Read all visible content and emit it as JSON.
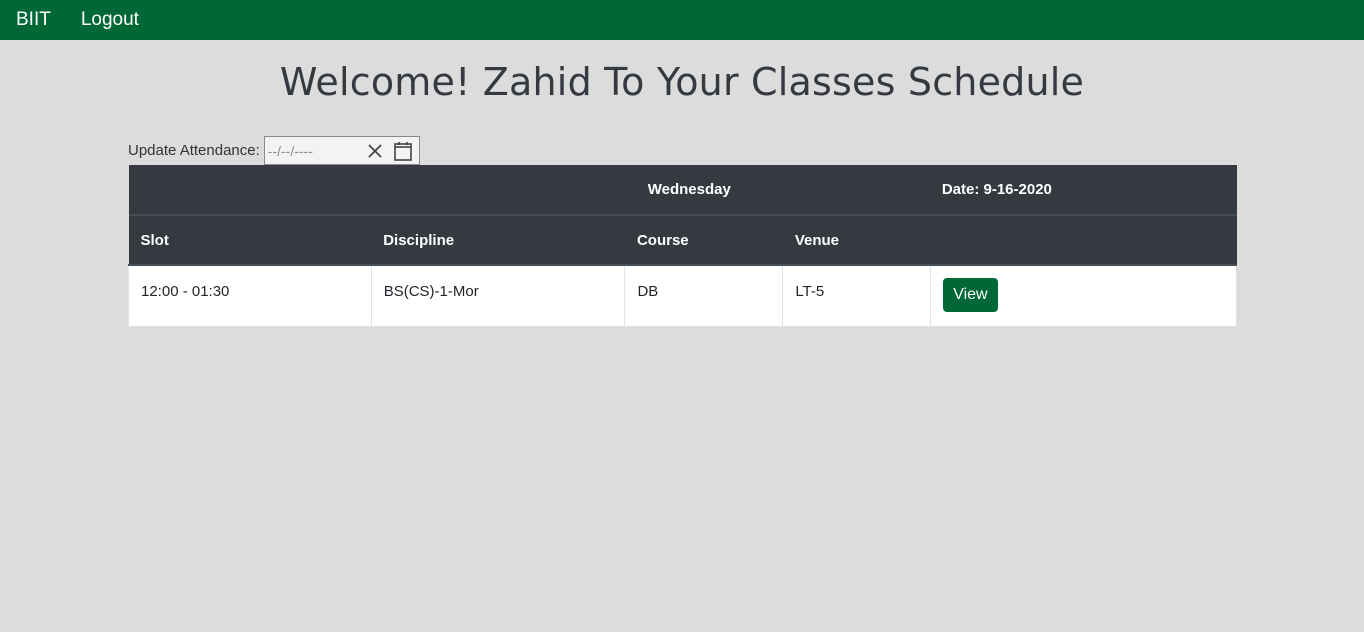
{
  "nav": {
    "brand": "BIIT",
    "logout": "Logout"
  },
  "title": "Welcome! Zahid To Your Classes Schedule",
  "attendance": {
    "label": "Update Attendance:",
    "date_placeholder": "--/--/----",
    "clear_icon": "close-icon",
    "calendar_icon": "calendar-icon"
  },
  "schedule": {
    "day": "Wednesday",
    "date": "Date: 9-16-2020",
    "columns": [
      "Slot",
      "Discipline",
      "Course",
      "Venue",
      ""
    ],
    "rows": [
      {
        "slot": "12:00 - 01:30",
        "discipline": "BS(CS)-1-Mor",
        "course": "DB",
        "venue": "LT-5",
        "action": "View"
      }
    ]
  },
  "colors": {
    "brand_green": "#006837",
    "table_header": "#343a40",
    "background": "#dcdcdc"
  }
}
